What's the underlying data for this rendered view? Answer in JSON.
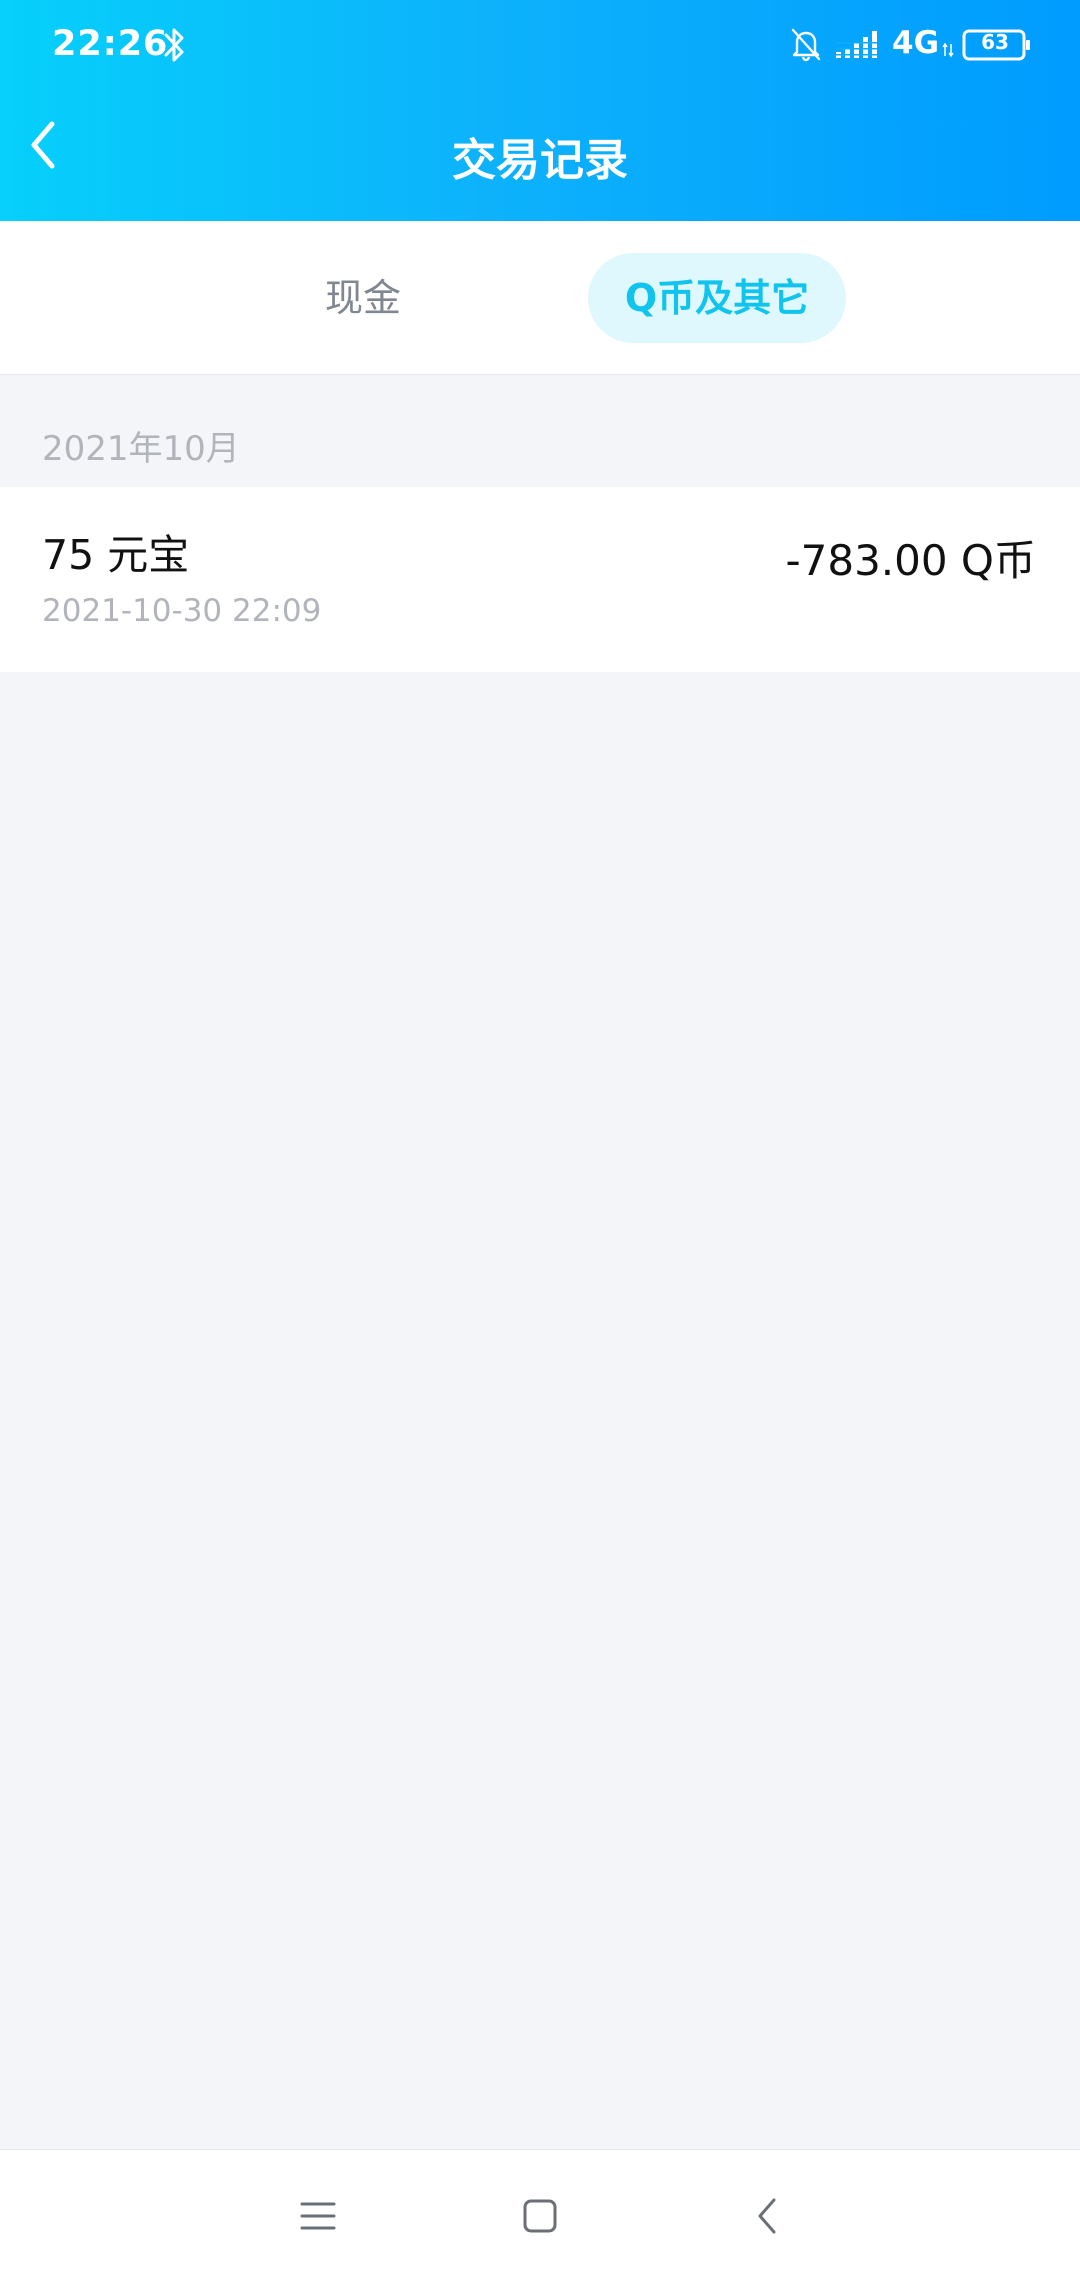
{
  "status_bar": {
    "time": "22:26",
    "network": "4G",
    "battery": "63",
    "icons": [
      "bluetooth-icon",
      "bell-muted-icon",
      "signal-icon",
      "battery-icon"
    ]
  },
  "header": {
    "title": "交易记录",
    "back_icon": "chevron-left-icon"
  },
  "tabs": [
    {
      "label": "现金",
      "active": false
    },
    {
      "label": "Q币及其它",
      "active": true
    }
  ],
  "transactions": {
    "month": "2021年10月",
    "items": [
      {
        "title": "75 元宝",
        "date": "2021-10-30 22:09",
        "amount": "-783.00 Q币"
      }
    ]
  },
  "system_nav": {
    "icons": [
      "menu-icon",
      "home-icon",
      "back-icon"
    ]
  },
  "colors": {
    "header_gradient_start": "#06d0fb",
    "header_gradient_end": "#009cff",
    "active_tab_bg": "#dff8fd",
    "active_tab_text": "#10c4ee",
    "page_bg": "#f3f5f9"
  }
}
